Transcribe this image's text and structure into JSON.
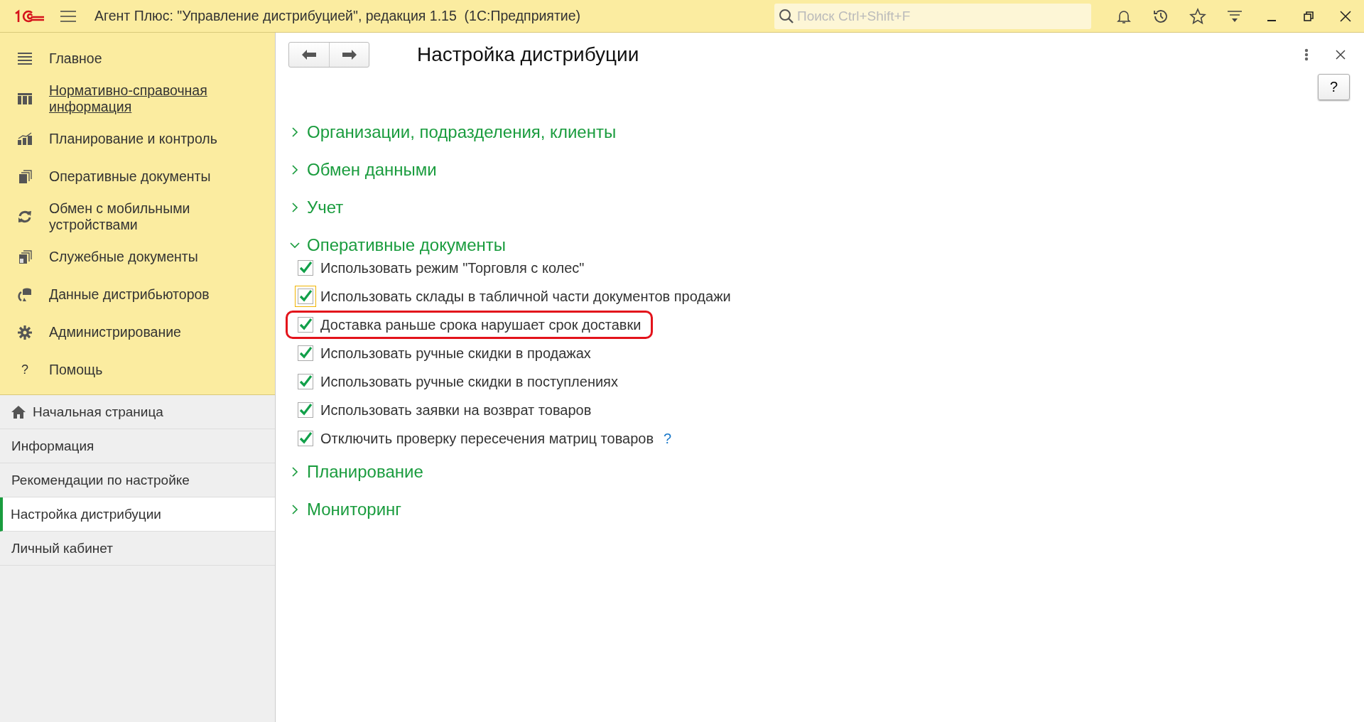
{
  "window": {
    "title": "Агент Плюс: \"Управление дистрибуцией\", редакция 1.15  (1С:Предприятие)"
  },
  "search": {
    "placeholder": "Поиск Ctrl+Shift+F"
  },
  "sidebar": {
    "sections": [
      {
        "label": "Главное",
        "link": false
      },
      {
        "label": "Нормативно-справочная информация",
        "link": true
      },
      {
        "label": "Планирование и контроль",
        "link": false
      },
      {
        "label": "Оперативные документы",
        "link": false
      },
      {
        "label": "Обмен с мобильными устройствами",
        "link": false
      },
      {
        "label": "Служебные документы",
        "link": false
      },
      {
        "label": "Данные дистрибьюторов",
        "link": false
      },
      {
        "label": "Администрирование",
        "link": false
      },
      {
        "label": "Помощь",
        "link": false
      }
    ],
    "help_glyph": "?",
    "nav": [
      {
        "label": "Начальная страница",
        "selected": false,
        "home": true
      },
      {
        "label": "Информация",
        "selected": false,
        "home": false
      },
      {
        "label": "Рекомендации по настройке",
        "selected": false,
        "home": false
      },
      {
        "label": "Настройка дистрибуции",
        "selected": true,
        "home": false
      },
      {
        "label": "Личный кабинет",
        "selected": false,
        "home": false
      }
    ]
  },
  "form": {
    "title": "Настройка дистрибуции",
    "help_button": "?",
    "groups": [
      {
        "label": "Организации, подразделения, клиенты",
        "expanded": false
      },
      {
        "label": "Обмен данными",
        "expanded": false
      },
      {
        "label": "Учет",
        "expanded": false
      },
      {
        "label": "Оперативные документы",
        "expanded": true,
        "options": [
          {
            "label": "Использовать режим \"Торговля с колес\"",
            "checked": true,
            "focused": false,
            "highlighted": false
          },
          {
            "label": "Использовать склады в табличной части документов продажи",
            "checked": true,
            "focused": true,
            "highlighted": false
          },
          {
            "label": "Доставка раньше срока нарушает срок доставки",
            "checked": true,
            "focused": false,
            "highlighted": true
          },
          {
            "label": "Использовать ручные скидки в продажах",
            "checked": true,
            "focused": false,
            "highlighted": false
          },
          {
            "label": "Использовать ручные скидки в поступлениях",
            "checked": true,
            "focused": false,
            "highlighted": false
          },
          {
            "label": "Использовать заявки на возврат товаров",
            "checked": true,
            "focused": false,
            "highlighted": false
          },
          {
            "label": "Отключить проверку пересечения матриц товаров",
            "checked": true,
            "focused": false,
            "highlighted": false,
            "help": "?"
          }
        ]
      },
      {
        "label": "Планирование",
        "expanded": false
      },
      {
        "label": "Мониторинг",
        "expanded": false
      }
    ]
  }
}
